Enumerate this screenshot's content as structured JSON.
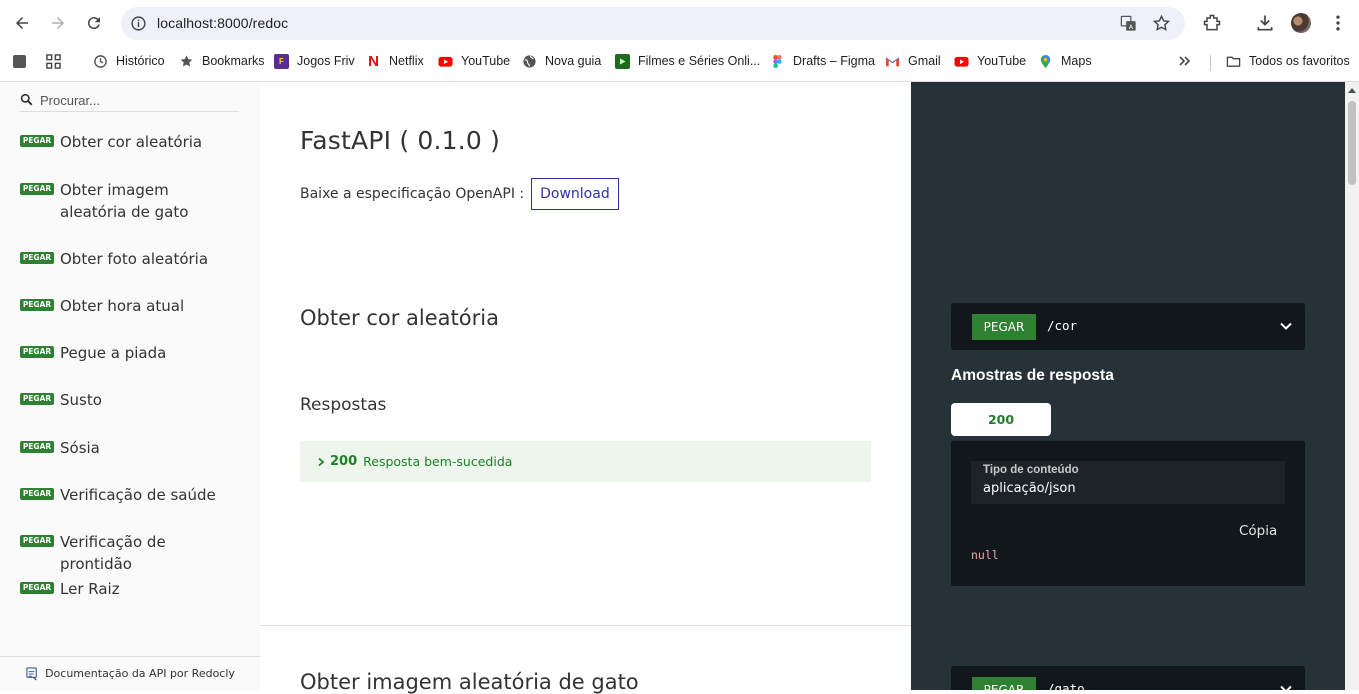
{
  "browser": {
    "url": "localhost:8000/redoc",
    "bookmarks": [
      {
        "label": "Histórico",
        "icon": "history-icon"
      },
      {
        "label": "Bookmarks",
        "icon": "star-icon"
      },
      {
        "label": "Jogos Friv",
        "icon": "friv-icon"
      },
      {
        "label": "Netflix",
        "icon": "netflix-icon"
      },
      {
        "label": "YouTube",
        "icon": "youtube-icon"
      },
      {
        "label": "Nova guia",
        "icon": "globe-icon"
      },
      {
        "label": "Filmes e Séries Onli...",
        "icon": "tv-icon"
      },
      {
        "label": "Drafts – Figma",
        "icon": "figma-icon"
      },
      {
        "label": "Gmail",
        "icon": "gmail-icon"
      },
      {
        "label": "YouTube",
        "icon": "youtube-icon"
      },
      {
        "label": "Maps",
        "icon": "maps-icon"
      }
    ],
    "all_bookmarks_label": "Todos os favoritos"
  },
  "sidebar": {
    "search_placeholder": "Procurar...",
    "items": [
      {
        "method": "PEGAR",
        "label": "Obter cor aleatória"
      },
      {
        "method": "PEGAR",
        "label": "Obter imagem aleatória de gato"
      },
      {
        "method": "PEGAR",
        "label": "Obter foto aleatória"
      },
      {
        "method": "PEGAR",
        "label": "Obter hora atual"
      },
      {
        "method": "PEGAR",
        "label": "Pegue a piada"
      },
      {
        "method": "PEGAR",
        "label": "Susto"
      },
      {
        "method": "PEGAR",
        "label": "Sósia"
      },
      {
        "method": "PEGAR",
        "label": "Verificação de saúde"
      },
      {
        "method": "PEGAR",
        "label": "Verificação de prontidão"
      },
      {
        "method": "PEGAR",
        "label": "Ler Raiz"
      }
    ],
    "footer": "Documentação da API por Redocly"
  },
  "main": {
    "title": "FastAPI ( 0.1.0 )",
    "spec_text": "Baixe a especificação OpenAPI :",
    "download_label": "Download",
    "operation_title": "Obter cor aleatória",
    "responses_title": "Respostas",
    "response_code": "200",
    "response_desc": "Resposta bem-sucedida",
    "next_operation_title": "Obter imagem aleatória de gato"
  },
  "right_panel": {
    "method": "PEGAR",
    "path": "/cor",
    "samples_title": "Amostras de resposta",
    "tab_label": "200",
    "content_type_label": "Tipo de conteúdo",
    "content_type_value": "aplicação/json",
    "copy_label": "Cópia",
    "sample_value": "null",
    "next_method": "PEGAR",
    "next_path": "/gato"
  },
  "colors": {
    "get_badge": "#2f8132",
    "right_panel_bg": "#263238",
    "code_bg": "#11171a",
    "response_success_bg": "#edf5ed",
    "download_border": "#32329f"
  }
}
